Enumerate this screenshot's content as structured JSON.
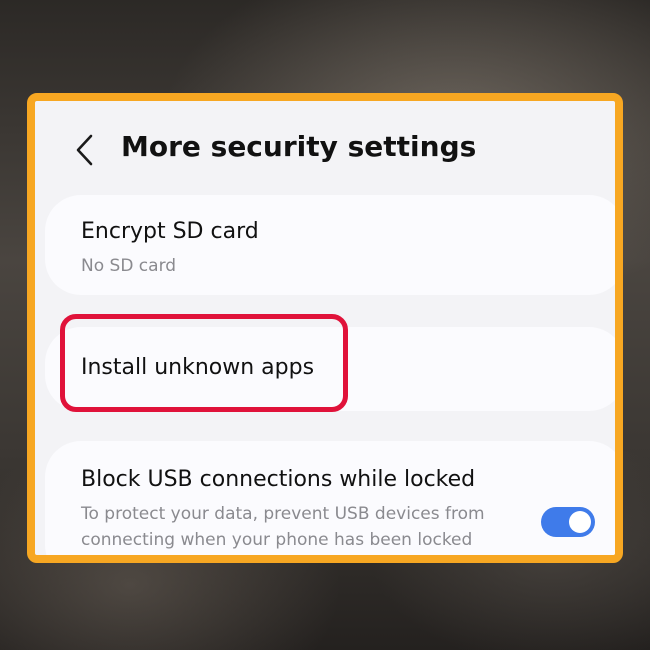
{
  "header": {
    "back_icon": "chevron-left-icon",
    "title": "More security settings"
  },
  "items": [
    {
      "title": "Encrypt SD card",
      "subtitle": "No SD card"
    },
    {
      "title": "Install unknown apps",
      "highlighted": true
    },
    {
      "title": "Block USB connections while locked",
      "subtitle_line1": "To protect your data, prevent USB devices from",
      "subtitle_line2": "connecting when your phone has been locked",
      "toggle_on": true
    }
  ],
  "colors": {
    "frame_border": "#f7a722",
    "highlight_border": "#e0123a",
    "toggle_on": "#3f7bea",
    "panel_background": "#f3f3f6",
    "card_background": "#fbfbfe"
  }
}
